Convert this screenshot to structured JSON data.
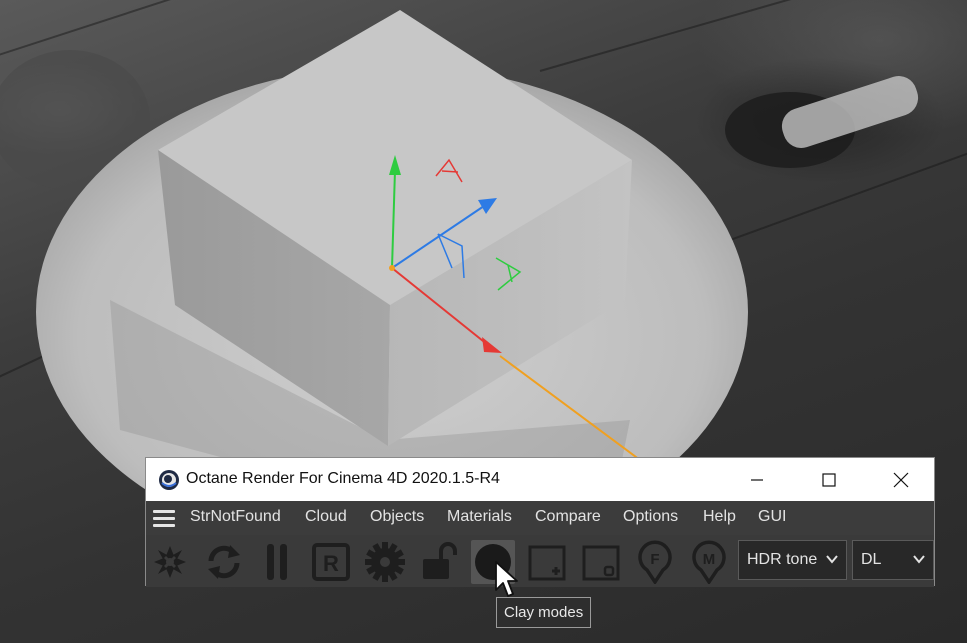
{
  "window": {
    "title": "Octane Render For Cinema 4D 2020.1.5-R4",
    "controls": {
      "minimize": "minimize-icon",
      "maximize": "maximize-icon",
      "close": "close-icon"
    }
  },
  "menu": {
    "icon": "hamburger-menu-icon",
    "items": [
      "StrNotFound",
      "Cloud",
      "Objects",
      "Materials",
      "Compare",
      "Options",
      "Help",
      "GUI"
    ]
  },
  "toolbar": {
    "tools": [
      {
        "icon": "octane-logo-icon"
      },
      {
        "icon": "refresh-icon"
      },
      {
        "icon": "pause-icon"
      },
      {
        "icon": "render-region-icon",
        "letter": "R"
      },
      {
        "icon": "settings-gear-icon"
      },
      {
        "icon": "unlock-icon"
      },
      {
        "icon": "clay-mode-icon",
        "active": true
      },
      {
        "icon": "add-region-icon"
      },
      {
        "icon": "subtract-region-icon"
      },
      {
        "icon": "focus-pick-icon",
        "letter": "F"
      },
      {
        "icon": "material-pick-icon",
        "letter": "M"
      }
    ],
    "tone_dropdown": "HDR tone",
    "kernel_dropdown": "DL"
  },
  "tooltip": "Clay modes",
  "viewport": {
    "gizmo_labels": {
      "x_axis": "A",
      "y_axis": "Y"
    },
    "axis_colors": {
      "x": "#e53935",
      "y": "#2ecc40",
      "z": "#2d7be5",
      "origin": "#f0a020"
    }
  }
}
